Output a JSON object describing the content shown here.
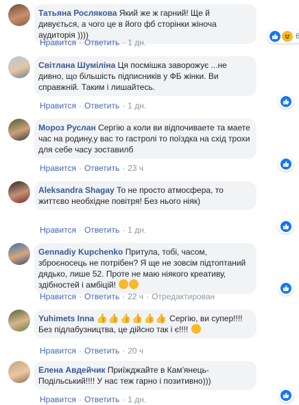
{
  "actions": {
    "like": "Нравится",
    "reply": "Ответить",
    "edited": "Отредактирован"
  },
  "comments": [
    {
      "author": "Татьяна Рослякова",
      "text": "Який же ж гарний! Ще й дивується, а чого це в його фб сторінки жіноча аудиторія ))))",
      "time": "1 дн.",
      "reaction_count": "6"
    },
    {
      "author": "Світлана Шуміліна",
      "text": "Ця посмішка заворожує ...не дивно, що більшість підписників у ФБ жінки. Ви справжній. Таким і лишайтесь.",
      "time": "1 дн."
    },
    {
      "author": "Мороз Руслан",
      "text": "Сергію а коли ви відпочиваете та маете час на родину,у вас то гастролі то поїздка на схід трохи для себе часу зоставилб",
      "time": "23 ч"
    },
    {
      "author": "Aleksandra Shagay",
      "text": "То не просто атмосфера, то життєво необхідне повітря! Без нього ніяк)",
      "time": "1 дн."
    },
    {
      "author": "Gennadiy Kupchenko",
      "text": "Притула, тобі, часом, зброєносець не потрібен? Я ще не зовсім підтоптаний дядько, лише 52. Проте не маю ніякого креативу, здібностей і амбіцій!",
      "time": "22 ч"
    },
    {
      "author": "Yuhimets Inna",
      "text": "Сергію, ви супер!!!! Без підлабузництва, це дійсно так і є!!!!",
      "time": "20 ч"
    },
    {
      "author": "Елена Авдейчик",
      "text": "Приїжджайте в Кам'янець-Подільський!!!! У нас теж гарно і позитивно)))",
      "time": "1 дн."
    }
  ],
  "colors": {
    "author": "#385898",
    "link": "#4267b2",
    "bubble": "#f2f3f5",
    "like_blue": "#1877f2",
    "haha_yellow": "#f7b928"
  },
  "icons": [
    "like-icon",
    "haha-icon",
    "smile-emoji-icon",
    "thumbs-up-emoji-icon"
  ]
}
